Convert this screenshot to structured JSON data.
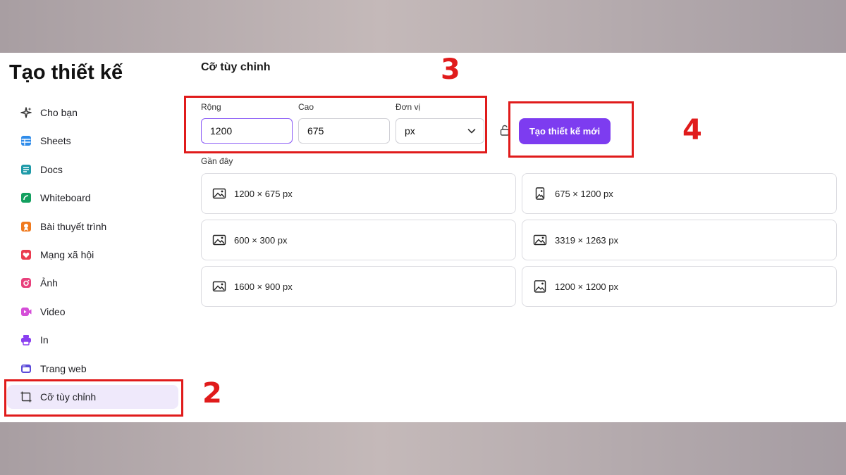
{
  "sidebar": {
    "heading": "Tạo thiết kế",
    "items": [
      {
        "label": "Cho bạn",
        "icon": "sparkle-icon"
      },
      {
        "label": "Sheets",
        "icon": "sheets-icon"
      },
      {
        "label": "Docs",
        "icon": "docs-icon"
      },
      {
        "label": "Whiteboard",
        "icon": "whiteboard-icon"
      },
      {
        "label": "Bài thuyết trình",
        "icon": "presentation-icon"
      },
      {
        "label": "Mạng xã hội",
        "icon": "heart-icon"
      },
      {
        "label": "Ảnh",
        "icon": "camera-icon"
      },
      {
        "label": "Video",
        "icon": "video-icon"
      },
      {
        "label": "In",
        "icon": "printer-icon"
      },
      {
        "label": "Trang web",
        "icon": "website-icon"
      },
      {
        "label": "Cỡ tùy chỉnh",
        "icon": "custom-size-icon",
        "active": true
      }
    ]
  },
  "main": {
    "title": "Cỡ tùy chỉnh",
    "width_label": "Rộng",
    "width_value": "1200",
    "height_label": "Cao",
    "height_value": "675",
    "unit_label": "Đơn vị",
    "unit_value": "px",
    "create_button": "Tạo thiết kế mới",
    "recent_label": "Gần đây",
    "recent": [
      {
        "label": "1200 × 675 px",
        "icon": "landscape-image-icon"
      },
      {
        "label": "675 × 1200 px",
        "icon": "portrait-image-icon"
      },
      {
        "label": "600 × 300 px",
        "icon": "landscape-image-icon"
      },
      {
        "label": "3319 × 1263 px",
        "icon": "landscape-image-icon"
      },
      {
        "label": "1600 × 900 px",
        "icon": "landscape-image-icon"
      },
      {
        "label": "1200 × 1200 px",
        "icon": "square-image-icon"
      }
    ]
  },
  "annotations": {
    "step2": "2",
    "step3": "3",
    "step4": "4"
  },
  "colors": {
    "accent": "#7d3cf0",
    "annotation": "#e01b1b",
    "active_bg": "#efe9fb"
  }
}
